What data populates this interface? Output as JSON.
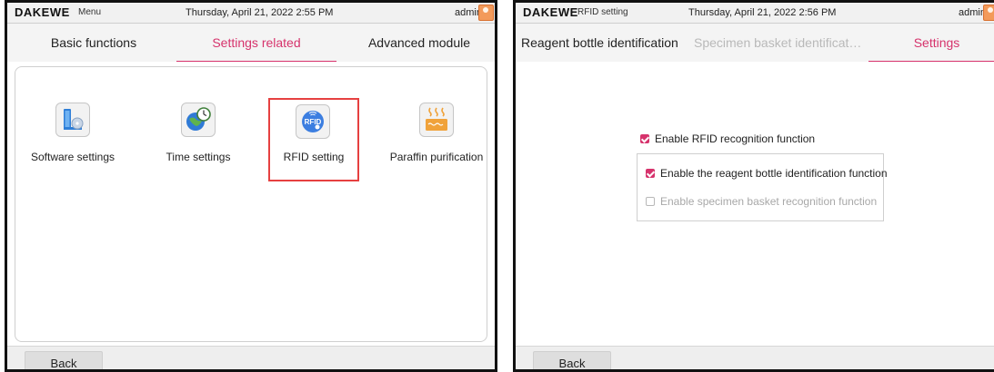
{
  "left": {
    "titlebar": {
      "logo": "DAKEWE",
      "screen_name": "Menu",
      "datetime": "Thursday, April 21, 2022  2:55 PM",
      "user": "admin"
    },
    "tabs": [
      {
        "label": "Basic functions",
        "active": false
      },
      {
        "label": "Settings related",
        "active": true
      },
      {
        "label": "Advanced module",
        "active": false
      }
    ],
    "tiles": [
      {
        "label": "Software settings",
        "icon": "software-install-icon"
      },
      {
        "label": "Time settings",
        "icon": "globe-clock-icon"
      },
      {
        "label": "RFID setting",
        "icon": "rfid-icon"
      },
      {
        "label": "Paraffin purification",
        "icon": "paraffin-heat-icon"
      }
    ],
    "back_label": "Back"
  },
  "right": {
    "titlebar": {
      "logo": "DAKEWE",
      "screen_name": "RFID setting",
      "datetime": "Thursday, April 21, 2022  2:56 PM",
      "user": "admin"
    },
    "tabs": [
      {
        "label": "Reagent bottle identification"
      },
      {
        "label": "Specimen basket identificat…"
      },
      {
        "label": "Settings"
      }
    ],
    "options": {
      "enable_rfid": {
        "label": "Enable RFID recognition function",
        "checked": true
      },
      "enable_reagent": {
        "label": "Enable the reagent bottle identification function",
        "checked": true
      },
      "enable_specimen": {
        "label": "Enable specimen basket recognition function",
        "checked": false
      }
    },
    "back_label": "Back"
  },
  "colors": {
    "accent": "#d6336c",
    "highlight": "#e64040",
    "rfid_blue": "#3c7ee0",
    "paraffin_orange": "#f0a23a"
  }
}
